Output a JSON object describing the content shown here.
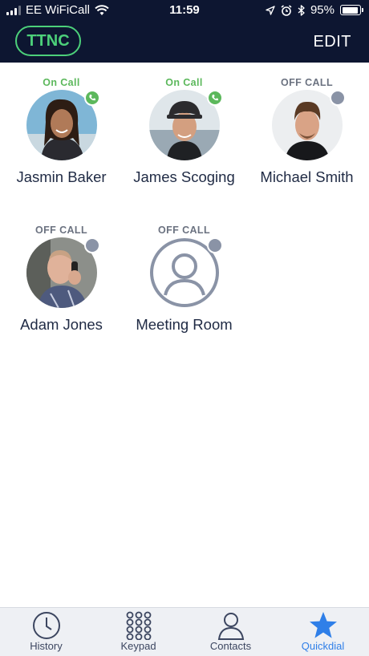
{
  "status_bar": {
    "carrier": "EE WiFiCall",
    "time": "11:59",
    "battery": "95%"
  },
  "header": {
    "brand": "TTNC",
    "edit_label": "EDIT",
    "brand_color": "#4cd07a"
  },
  "contacts": [
    {
      "name": "Jasmin Baker",
      "status": "On Call",
      "state": "on",
      "avatar_icon": "photo-avatar-icon"
    },
    {
      "name": "James Scoging",
      "status": "On Call",
      "state": "on",
      "avatar_icon": "photo-avatar-icon"
    },
    {
      "name": "Michael Smith",
      "status": "OFF CALL",
      "state": "off",
      "avatar_icon": "photo-avatar-icon"
    },
    {
      "name": "Adam Jones",
      "status": "OFF CALL",
      "state": "off",
      "avatar_icon": "photo-avatar-icon"
    },
    {
      "name": "Meeting Room",
      "status": "OFF CALL",
      "state": "off",
      "avatar_icon": "person-outline-icon"
    }
  ],
  "tabs": [
    {
      "label": "History",
      "icon": "clock-icon",
      "active": false
    },
    {
      "label": "Keypad",
      "icon": "keypad-icon",
      "active": false
    },
    {
      "label": "Contacts",
      "icon": "person-icon",
      "active": false
    },
    {
      "label": "Quickdial",
      "icon": "star-icon",
      "active": true
    }
  ],
  "colors": {
    "on_call": "#5cb85c",
    "off_call": "#8a93a6",
    "active_tab": "#2f7fe8",
    "header_bg": "#0d1631"
  }
}
